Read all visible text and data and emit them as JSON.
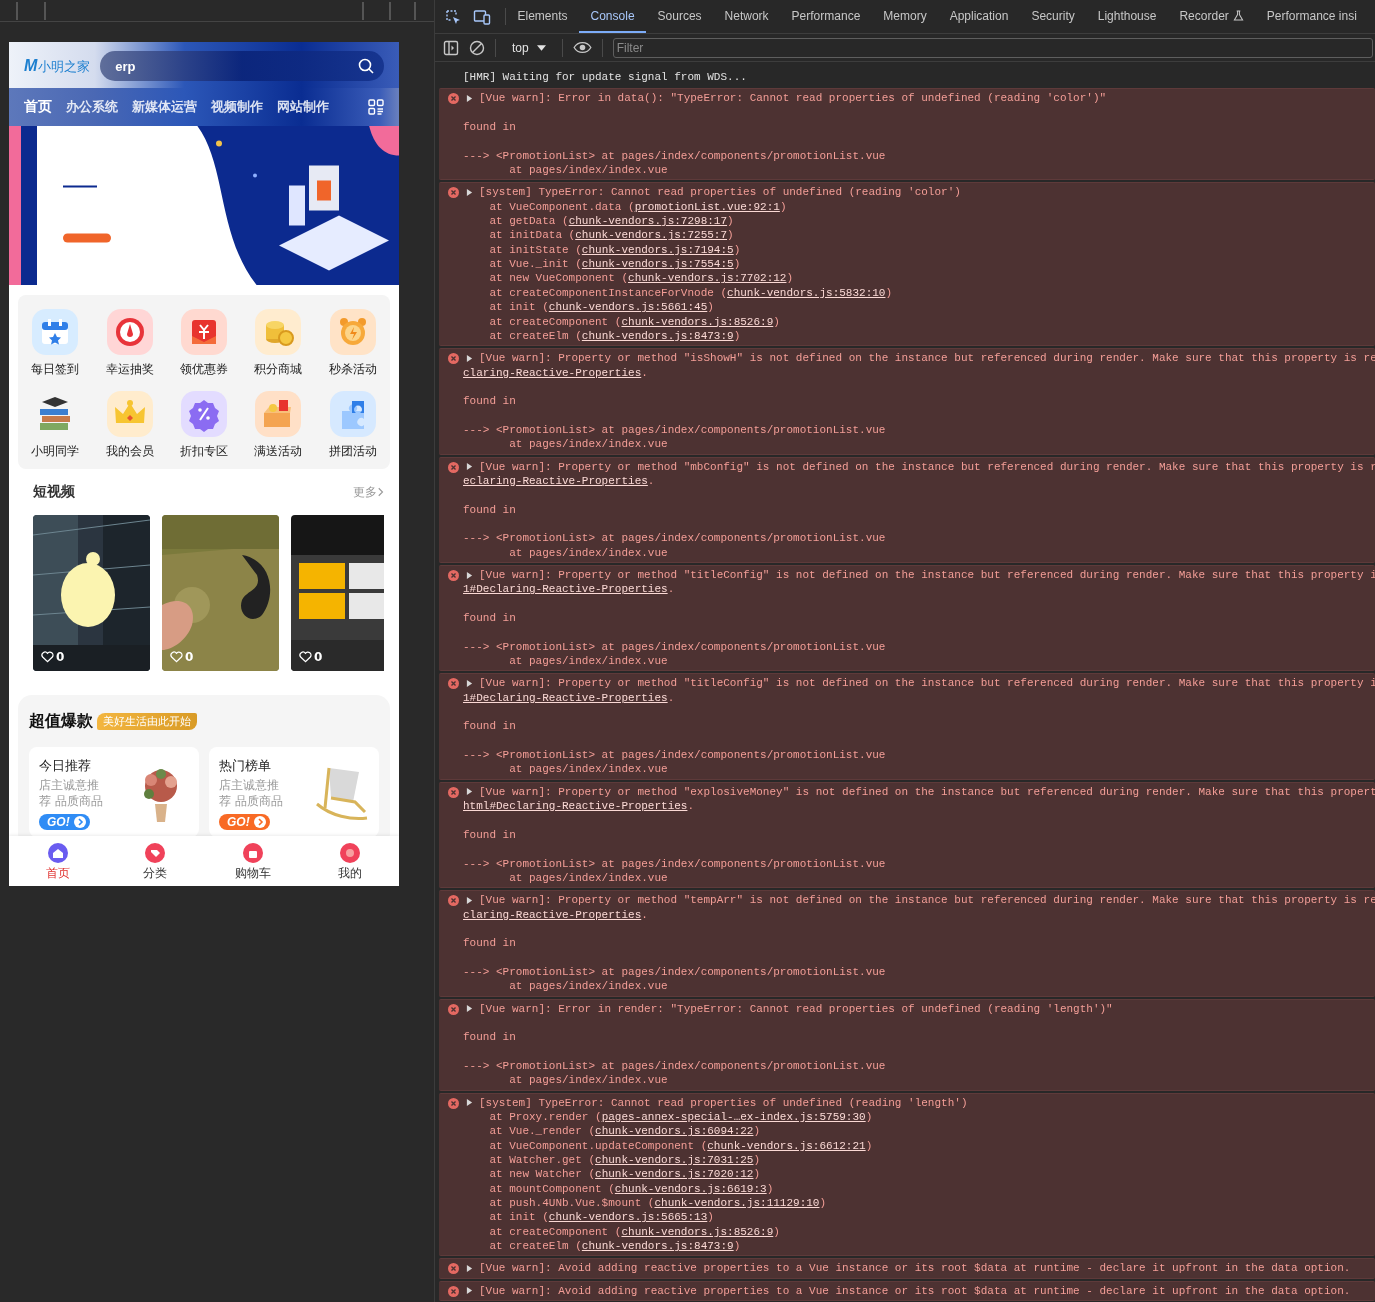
{
  "phone": {
    "logo_mark": "M",
    "brand": "小明之家",
    "search": {
      "value": "erp"
    },
    "nav": [
      {
        "label": "首页",
        "selected": true
      },
      {
        "label": "办公系统",
        "selected": false
      },
      {
        "label": "新媒体运营",
        "selected": false
      },
      {
        "label": "视频制作",
        "selected": false
      },
      {
        "label": "网站制作",
        "selected": false
      }
    ],
    "shortcuts": [
      {
        "label": "每日签到"
      },
      {
        "label": "幸运抽奖"
      },
      {
        "label": "领优惠券"
      },
      {
        "label": "积分商城"
      },
      {
        "label": "秒杀活动"
      },
      {
        "label": "小明同学"
      },
      {
        "label": "我的会员"
      },
      {
        "label": "折扣专区"
      },
      {
        "label": "满送活动"
      },
      {
        "label": "拼团活动"
      }
    ],
    "videos": {
      "title": "短视频",
      "more": "更多",
      "items": [
        {
          "likes": "0"
        },
        {
          "likes": "0"
        },
        {
          "likes": "0"
        }
      ]
    },
    "deals": {
      "title": "超值爆款",
      "tag": "美好生活由此开始",
      "cards": [
        {
          "title": "今日推荐",
          "desc": "店主诚意推荐 品质商品",
          "button": "GO!",
          "color": "#2f8cf5"
        },
        {
          "title": "热门榜单",
          "desc": "店主诚意推荐 品质商品",
          "button": "GO!",
          "color": "#f86a25"
        }
      ]
    },
    "tabbar": [
      {
        "label": "首页",
        "selected": true
      },
      {
        "label": "分类",
        "selected": false
      },
      {
        "label": "购物车",
        "selected": false
      },
      {
        "label": "我的",
        "selected": false
      }
    ]
  },
  "devtools": {
    "tabs": [
      {
        "label": "Elements",
        "selected": false
      },
      {
        "label": "Console",
        "selected": true
      },
      {
        "label": "Sources",
        "selected": false
      },
      {
        "label": "Network",
        "selected": false
      },
      {
        "label": "Performance",
        "selected": false
      },
      {
        "label": "Memory",
        "selected": false
      },
      {
        "label": "Application",
        "selected": false
      },
      {
        "label": "Security",
        "selected": false
      },
      {
        "label": "Lighthouse",
        "selected": false
      },
      {
        "label": "Recorder",
        "selected": false
      },
      {
        "label": "Performance insi",
        "selected": false
      }
    ],
    "context": "top",
    "filter": {
      "placeholder": "Filter"
    },
    "messages": [
      {
        "kind": "log",
        "head": "[HMR] Waiting for update signal from WDS..."
      },
      {
        "kind": "error",
        "head": "[Vue warn]: Error in data(): \"TypeError: Cannot read properties of undefined (reading 'color')\"",
        "lines": [
          {
            "kind": "para",
            "pre": "found in"
          },
          {
            "kind": "para",
            "pre": "---> <PromotionList> at pages/index/components/promotionList.vue"
          },
          {
            "kind": "line",
            "pre": "       at pages/index/index.vue"
          }
        ]
      },
      {
        "kind": "error",
        "head": "[system] TypeError: Cannot read properties of undefined (reading 'color')",
        "lines": [
          {
            "kind": "line",
            "pre": "    at VueComponent.data (",
            "link": "promotionList.vue:92:1",
            "post": ")"
          },
          {
            "kind": "line",
            "pre": "    at getData (",
            "link": "chunk-vendors.js:7298:17",
            "post": ")"
          },
          {
            "kind": "line",
            "pre": "    at initData (",
            "link": "chunk-vendors.js:7255:7",
            "post": ")"
          },
          {
            "kind": "line",
            "pre": "    at initState (",
            "link": "chunk-vendors.js:7194:5",
            "post": ")"
          },
          {
            "kind": "line",
            "pre": "    at Vue._init (",
            "link": "chunk-vendors.js:7554:5",
            "post": ")"
          },
          {
            "kind": "line",
            "pre": "    at new VueComponent (",
            "link": "chunk-vendors.js:7702:12",
            "post": ")"
          },
          {
            "kind": "line",
            "pre": "    at createComponentInstanceForVnode (",
            "link": "chunk-vendors.js:5832:10",
            "post": ")"
          },
          {
            "kind": "line",
            "pre": "    at init (",
            "link": "chunk-vendors.js:5661:45",
            "post": ")"
          },
          {
            "kind": "line",
            "pre": "    at createComponent (",
            "link": "chunk-vendors.js:8526:9",
            "post": ")"
          },
          {
            "kind": "line",
            "pre": "    at createElm (",
            "link": "chunk-vendors.js:8473:9",
            "post": ")"
          }
        ]
      },
      {
        "kind": "error",
        "head": "[Vue warn]: Property or method \"isShowH\" is not defined on the instance but referenced during render. Make sure that this property is re",
        "lines": [
          {
            "kind": "line",
            "link": "claring-Reactive-Properties",
            "post": "."
          },
          {
            "kind": "para",
            "pre": "found in"
          },
          {
            "kind": "para",
            "pre": "---> <PromotionList> at pages/index/components/promotionList.vue"
          },
          {
            "kind": "line",
            "pre": "       at pages/index/index.vue"
          }
        ]
      },
      {
        "kind": "error",
        "head": "[Vue warn]: Property or method \"mbConfig\" is not defined on the instance but referenced during render. Make sure that this property is r",
        "lines": [
          {
            "kind": "line",
            "link": "eclaring-Reactive-Properties",
            "post": "."
          },
          {
            "kind": "para",
            "pre": "found in"
          },
          {
            "kind": "para",
            "pre": "---> <PromotionList> at pages/index/components/promotionList.vue"
          },
          {
            "kind": "line",
            "pre": "       at pages/index/index.vue"
          }
        ]
      },
      {
        "kind": "error",
        "head": "[Vue warn]: Property or method \"titleConfig\" is not defined on the instance but referenced during render. Make sure that this property i",
        "lines": [
          {
            "kind": "line",
            "link": "1#Declaring-Reactive-Properties",
            "post": "."
          },
          {
            "kind": "para",
            "pre": "found in"
          },
          {
            "kind": "para",
            "pre": "---> <PromotionList> at pages/index/components/promotionList.vue"
          },
          {
            "kind": "line",
            "pre": "       at pages/index/index.vue"
          }
        ]
      },
      {
        "kind": "error",
        "head": "[Vue warn]: Property or method \"titleConfig\" is not defined on the instance but referenced during render. Make sure that this property i",
        "lines": [
          {
            "kind": "line",
            "link": "1#Declaring-Reactive-Properties",
            "post": "."
          },
          {
            "kind": "para",
            "pre": "found in"
          },
          {
            "kind": "para",
            "pre": "---> <PromotionList> at pages/index/components/promotionList.vue"
          },
          {
            "kind": "line",
            "pre": "       at pages/index/index.vue"
          }
        ]
      },
      {
        "kind": "error",
        "head": "[Vue warn]: Property or method \"explosiveMoney\" is not defined on the instance but referenced during render. Make sure that this propert",
        "lines": [
          {
            "kind": "line",
            "link": "html#Declaring-Reactive-Properties",
            "post": "."
          },
          {
            "kind": "para",
            "pre": "found in"
          },
          {
            "kind": "para",
            "pre": "---> <PromotionList> at pages/index/components/promotionList.vue"
          },
          {
            "kind": "line",
            "pre": "       at pages/index/index.vue"
          }
        ]
      },
      {
        "kind": "error",
        "head": "[Vue warn]: Property or method \"tempArr\" is not defined on the instance but referenced during render. Make sure that this property is re",
        "lines": [
          {
            "kind": "line",
            "link": "claring-Reactive-Properties",
            "post": "."
          },
          {
            "kind": "para",
            "pre": "found in"
          },
          {
            "kind": "para",
            "pre": "---> <PromotionList> at pages/index/components/promotionList.vue"
          },
          {
            "kind": "line",
            "pre": "       at pages/index/index.vue"
          }
        ]
      },
      {
        "kind": "error",
        "head": "[Vue warn]: Error in render: \"TypeError: Cannot read properties of undefined (reading 'length')\"",
        "lines": [
          {
            "kind": "para",
            "pre": "found in"
          },
          {
            "kind": "para",
            "pre": "---> <PromotionList> at pages/index/components/promotionList.vue"
          },
          {
            "kind": "line",
            "pre": "       at pages/index/index.vue"
          }
        ]
      },
      {
        "kind": "error",
        "head": "[system] TypeError: Cannot read properties of undefined (reading 'length')",
        "lines": [
          {
            "kind": "line",
            "pre": "    at Proxy.render (",
            "link": "pages-annex-special-…ex-index.js:5759:30",
            "post": ")"
          },
          {
            "kind": "line",
            "pre": "    at Vue._render (",
            "link": "chunk-vendors.js:6094:22",
            "post": ")"
          },
          {
            "kind": "line",
            "pre": "    at VueComponent.updateComponent (",
            "link": "chunk-vendors.js:6612:21",
            "post": ")"
          },
          {
            "kind": "line",
            "pre": "    at Watcher.get (",
            "link": "chunk-vendors.js:7031:25",
            "post": ")"
          },
          {
            "kind": "line",
            "pre": "    at new Watcher (",
            "link": "chunk-vendors.js:7020:12",
            "post": ")"
          },
          {
            "kind": "line",
            "pre": "    at mountComponent (",
            "link": "chunk-vendors.js:6619:3",
            "post": ")"
          },
          {
            "kind": "line",
            "pre": "    at push.4UNb.Vue.$mount (",
            "link": "chunk-vendors.js:11129:10",
            "post": ")"
          },
          {
            "kind": "line",
            "pre": "    at init (",
            "link": "chunk-vendors.js:5665:13",
            "post": ")"
          },
          {
            "kind": "line",
            "pre": "    at createComponent (",
            "link": "chunk-vendors.js:8526:9",
            "post": ")"
          },
          {
            "kind": "line",
            "pre": "    at createElm (",
            "link": "chunk-vendors.js:8473:9",
            "post": ")"
          }
        ]
      },
      {
        "kind": "error",
        "head": "[Vue warn]: Avoid adding reactive properties to a Vue instance or its root $data at runtime - declare it upfront in the data option."
      },
      {
        "kind": "error",
        "head": "[Vue warn]: Avoid adding reactive properties to a Vue instance or its root $data at runtime - declare it upfront in the data option."
      }
    ]
  }
}
